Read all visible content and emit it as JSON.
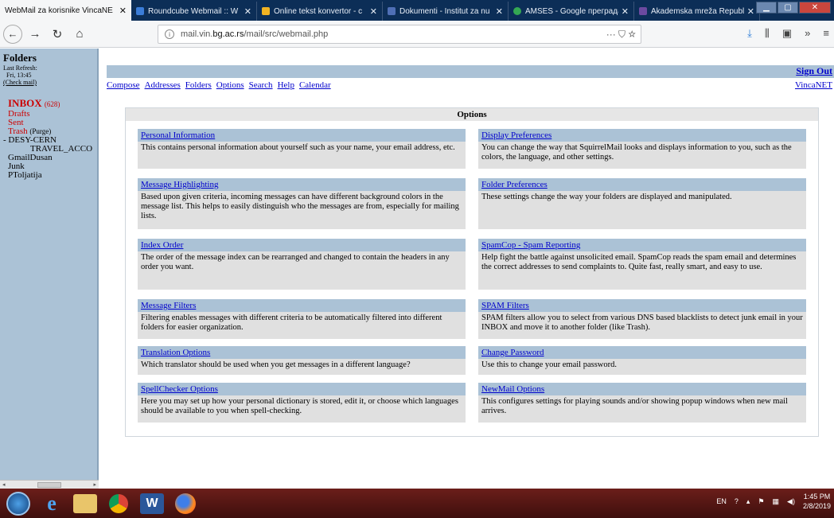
{
  "browser": {
    "tabs": [
      {
        "title": "WebMail za korisnike VincaNE",
        "active": true,
        "color": "#ffffff"
      },
      {
        "title": "Roundcube Webmail :: W",
        "active": false,
        "color": "#3b7dd8"
      },
      {
        "title": "Online tekst konvertor - c",
        "active": false,
        "color": "#f0b323"
      },
      {
        "title": "Dokumenti - Institut za nu",
        "active": false,
        "color": "#4f6fb5"
      },
      {
        "title": "AMSES - Google преграда",
        "active": false,
        "color": "#34a853"
      },
      {
        "title": "Akademska mreža Republ",
        "active": false,
        "color": "#6c4aa0"
      }
    ],
    "new_tab_label": "+",
    "url_grey_prefix": "mail.vin.",
    "url_domain": "bg.ac.rs",
    "url_path": "/mail/src/webmail.php",
    "url_actions": "··· ⛉ ☆"
  },
  "sidebar": {
    "title": "Folders",
    "last_refresh_label": "Last Refresh:",
    "last_refresh_time": "Fri, 13:45",
    "check_mail": "(Check mail)",
    "folders": [
      {
        "name": "INBOX",
        "count": "(628)"
      },
      {
        "name": "Drafts"
      },
      {
        "name": "Sent"
      },
      {
        "name": "Trash",
        "extra": "(Purge)"
      },
      {
        "name": "DESY-CERN",
        "prefix": "- "
      },
      {
        "name": "TRAVEL_ACCO"
      },
      {
        "name": "GmailDusan"
      },
      {
        "name": "Junk"
      },
      {
        "name": "PToljatija"
      }
    ]
  },
  "header": {
    "sign_out": "Sign Out",
    "org": "VincaNET",
    "menu": [
      "Compose",
      "Addresses",
      "Folders",
      "Options",
      "Search",
      "Help",
      "Calendar"
    ]
  },
  "options": {
    "title": "Options",
    "items": [
      {
        "title": "Personal Information",
        "desc": "This contains personal information about yourself such as your name, your email address, etc."
      },
      {
        "title": "Display Preferences",
        "desc": "You can change the way that SquirrelMail looks and displays information to you, such as the colors, the language, and other settings."
      },
      {
        "title": "Message Highlighting",
        "desc": "Based upon given criteria, incoming messages can have different background colors in the message list. This helps to easily distinguish who the messages are from, especially for mailing lists."
      },
      {
        "title": "Folder Preferences",
        "desc": "These settings change the way your folders are displayed and manipulated."
      },
      {
        "title": "Index Order",
        "desc": "The order of the message index can be rearranged and changed to contain the headers in any order you want."
      },
      {
        "title": "SpamCop - Spam Reporting",
        "desc": "Help fight the battle against unsolicited email. SpamCop reads the spam email and determines the correct addresses to send complaints to. Quite fast, really smart, and easy to use."
      },
      {
        "title": "Message Filters",
        "desc": "Filtering enables messages with different criteria to be automatically filtered into different folders for easier organization."
      },
      {
        "title": "SPAM Filters",
        "desc": "SPAM filters allow you to select from various DNS based blacklists to detect junk email in your INBOX and move it to another folder (like Trash)."
      },
      {
        "title": "Translation Options",
        "desc": "Which translator should be used when you get messages in a different language?"
      },
      {
        "title": "Change Password",
        "desc": "Use this to change your email password."
      },
      {
        "title": "SpellChecker Options",
        "desc": "Here you may set up how your personal dictionary is stored, edit it, or choose which languages should be available to you when spell-checking."
      },
      {
        "title": "NewMail Options",
        "desc": "This configures settings for playing sounds and/or showing popup windows when new mail arrives."
      }
    ]
  },
  "taskbar": {
    "lang": "EN",
    "time": "1:45 PM",
    "date": "2/8/2019"
  }
}
